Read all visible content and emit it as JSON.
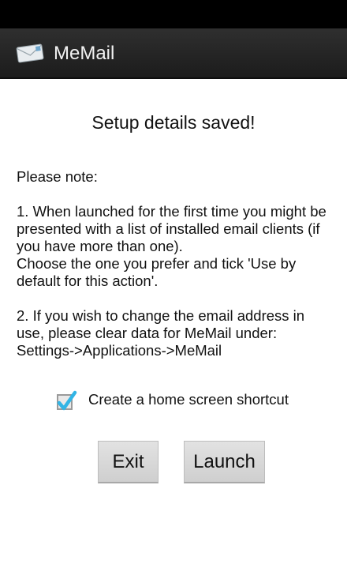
{
  "app": {
    "title": "MeMail"
  },
  "icons": {
    "app_icon": "envelope-icon",
    "checkbox": "checkmark-icon"
  },
  "colors": {
    "action_bar": "#222222",
    "checkbox_accent": "#33b5e5"
  },
  "content": {
    "headline": "Setup details saved!",
    "note_heading": "Please note:",
    "note_1": "1. When launched for the first time you might be presented with a list of installed email clients (if you have more than one).\nChoose the one you prefer and tick 'Use by default for this action'.",
    "note_2": "2. If you wish to change the email address in use, please clear data for MeMail under:\nSettings->Applications->MeMail"
  },
  "shortcut": {
    "label": "Create a home screen shortcut",
    "checked": true
  },
  "buttons": {
    "exit": "Exit",
    "launch": "Launch"
  }
}
